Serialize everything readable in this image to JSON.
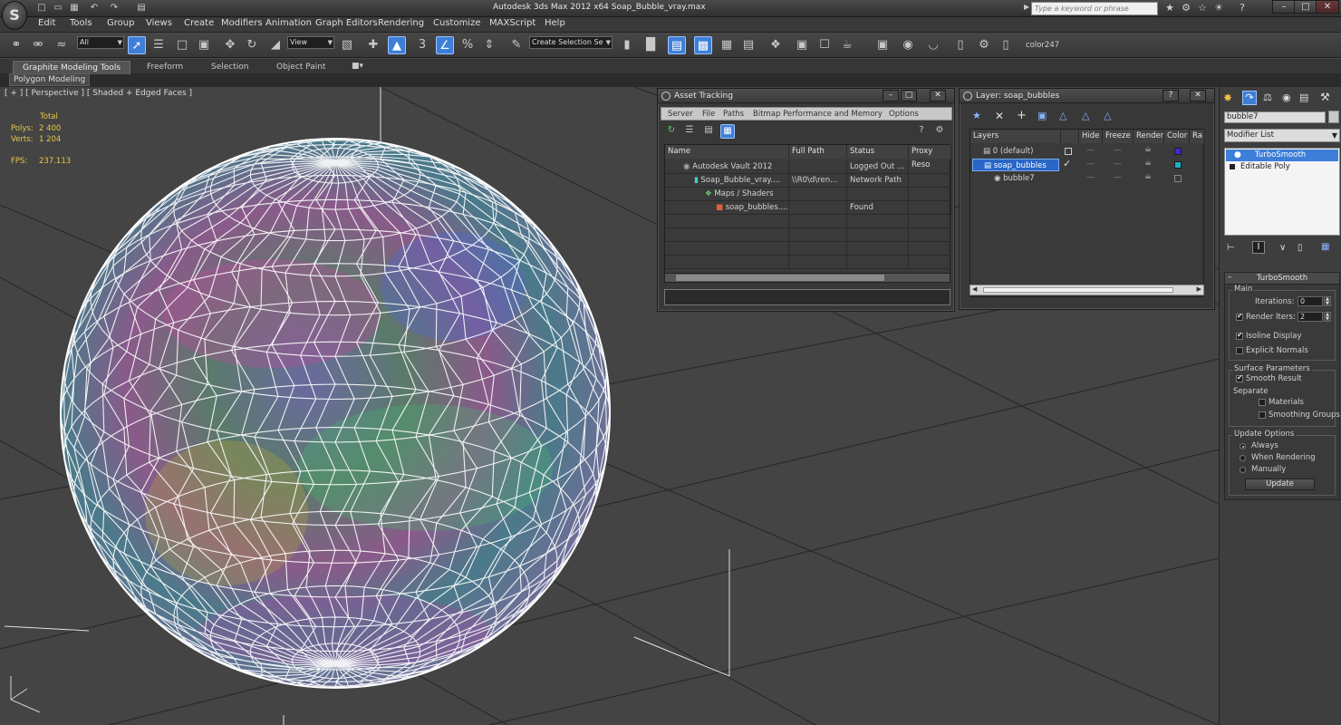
{
  "app": {
    "logo_letter": "S",
    "window_title": "Autodesk 3ds Max  2012 x64     Soap_Bubble_vray.max",
    "search_placeholder": "Type a keyword or phrase"
  },
  "menu": [
    "Edit",
    "Tools",
    "Group",
    "Views",
    "Create",
    "Modifiers",
    "Animation",
    "Graph Editors",
    "Rendering",
    "Customize",
    "MAXScript",
    "Help"
  ],
  "toolbar": {
    "selection_filter": "All",
    "ref_coord": "View",
    "named_selection_placeholder": "Create Selection Se",
    "color_label": "color247"
  },
  "ribbon": {
    "tabs": [
      "Graphite Modeling Tools",
      "Freeform",
      "Selection",
      "Object Paint"
    ],
    "subtab": "Polygon Modeling"
  },
  "viewport": {
    "label": "[ + ] [ Perspective ] [ Shaded + Edged Faces ]",
    "stats_header": "Total",
    "polys_label": "Polys:",
    "polys_value": "2 400",
    "verts_label": "Verts:",
    "verts_value": "1 204",
    "fps_label": "FPS:",
    "fps_value": "237.113",
    "bg_color": "#444444",
    "wire_color": "#ffffff"
  },
  "asset_tracking": {
    "title": "Asset Tracking",
    "menu": [
      "Server",
      "File",
      "Paths",
      "Bitmap Performance and Memory",
      "Options"
    ],
    "columns": [
      "Name",
      "Full Path",
      "Status",
      "Proxy Reso"
    ],
    "rows": [
      {
        "name": "Autodesk Vault 2012",
        "path": "",
        "status": "Logged Out ..."
      },
      {
        "name": "Soap_Bubble_vray....",
        "path": "\\\\R0\\d\\ren...",
        "status": "Network Path"
      },
      {
        "name": "Maps / Shaders",
        "path": "",
        "status": ""
      },
      {
        "name": "soap_bubbles....",
        "path": "",
        "status": "Found"
      }
    ]
  },
  "layer_manager": {
    "title": "Layer: soap_bubbles",
    "help": "?",
    "columns": [
      "Layers",
      "Hide",
      "Freeze",
      "Render",
      "Color",
      "Ra"
    ],
    "rows": [
      {
        "name": "0 (default)",
        "color": "#3a2ad8",
        "selected": false
      },
      {
        "name": "soap_bubbles",
        "color": "#1ab0c8",
        "selected": true
      },
      {
        "name": "bubble7",
        "color": "#3a3a3a",
        "selected": false
      }
    ],
    "select_color": "#2a66c8"
  },
  "command_panel": {
    "object_name": "bubble7",
    "modifier_list": "Modifier List",
    "stack": [
      "TurboSmooth",
      "Editable Poly"
    ],
    "rollout_title": "TurboSmooth",
    "main_group": "Main",
    "iterations_label": "Iterations:",
    "iterations_value": "0",
    "render_iters_label": "Render Iters:",
    "render_iters_value": "2",
    "isoline_label": "Isoline Display",
    "explicit_normals_label": "Explicit Normals",
    "surface_group": "Surface Parameters",
    "smooth_result_label": "Smooth Result",
    "separate_label": "Separate",
    "materials_label": "Materials",
    "smoothing_groups_label": "Smoothing Groups",
    "update_group": "Update Options",
    "always_label": "Always",
    "when_rendering_label": "When Rendering",
    "manually_label": "Manually",
    "update_button": "Update"
  }
}
